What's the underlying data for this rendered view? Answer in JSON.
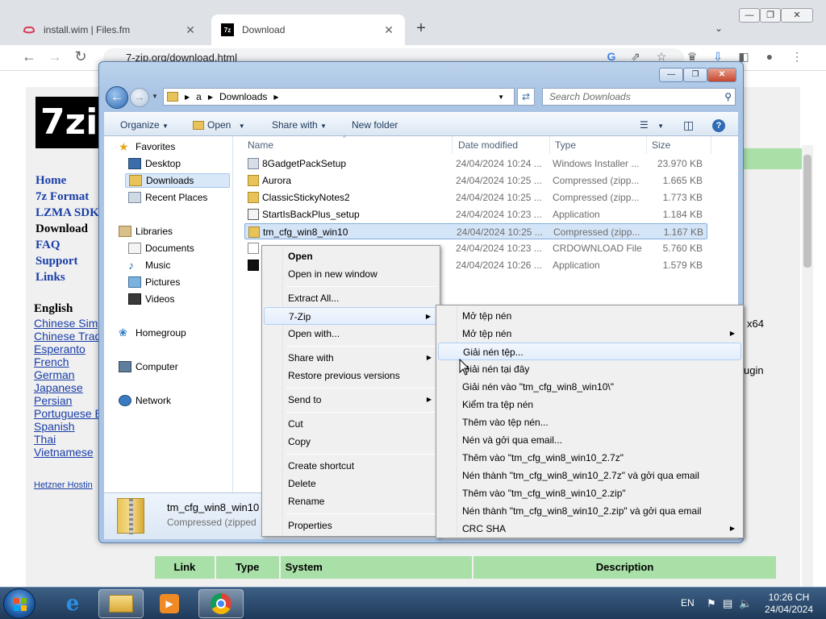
{
  "browser": {
    "tabs": [
      {
        "title": "install.wim | Files.fm",
        "close": "✕"
      },
      {
        "title": "Download",
        "close": "✕"
      }
    ],
    "new_tab": "+",
    "url": "7-zip.org/download.html",
    "window_buttons": {
      "minimize": "—",
      "restore": "❐",
      "close": "✕"
    }
  },
  "website": {
    "logo": "7zi",
    "nav": [
      "Home",
      "7z Format",
      "LZMA SDK",
      "Download",
      "FAQ",
      "Support",
      "Links"
    ],
    "languages_header": "English",
    "languages": [
      "Chinese Simp",
      "Chinese Trad",
      "Esperanto",
      "French",
      "German",
      "Japanese",
      "Persian",
      "Portuguese B",
      "Spanish",
      "Thai",
      "Vietnamese"
    ],
    "hosting": "Hetzner Hostin",
    "right_fragments": {
      "x64": "x64",
      "plugin": "ugin"
    },
    "table_headers": [
      "Link",
      "Type",
      "System",
      "Description"
    ]
  },
  "explorer": {
    "breadcrumb": [
      "a",
      "Downloads"
    ],
    "search_placeholder": "Search Downloads",
    "commands": [
      "Organize",
      "Open",
      "Share with",
      "New folder"
    ],
    "nav": {
      "favorites_header": "Favorites",
      "favorites": [
        "Desktop",
        "Downloads",
        "Recent Places"
      ],
      "libraries_header": "Libraries",
      "libraries": [
        "Documents",
        "Music",
        "Pictures",
        "Videos"
      ],
      "homegroup": "Homegroup",
      "computer": "Computer",
      "network": "Network"
    },
    "columns": [
      "Name",
      "Date modified",
      "Type",
      "Size"
    ],
    "files": [
      {
        "name": "8GadgetPackSetup",
        "date": "24/04/2024 10:24 ...",
        "type": "Windows Installer ...",
        "size": "23.970 KB"
      },
      {
        "name": "Aurora",
        "date": "24/04/2024 10:25 ...",
        "type": "Compressed (zipp...",
        "size": "1.665 KB"
      },
      {
        "name": "ClassicStickyNotes2",
        "date": "24/04/2024 10:25 ...",
        "type": "Compressed (zipp...",
        "size": "1.773 KB"
      },
      {
        "name": "StartIsBackPlus_setup",
        "date": "24/04/2024 10:23 ...",
        "type": "Application",
        "size": "1.184 KB"
      },
      {
        "name": "tm_cfg_win8_win10",
        "date": "24/04/2024 10:25 ...",
        "type": "Compressed (zipp...",
        "size": "1.167 KB"
      },
      {
        "name": "",
        "date": "24/04/2024 10:23 ...",
        "type": "CRDOWNLOAD File",
        "size": "5.760 KB"
      },
      {
        "name": "",
        "date": "24/04/2024 10:26 ...",
        "type": "Application",
        "size": "1.579 KB"
      }
    ],
    "details": {
      "name": "tm_cfg_win8_win10",
      "type": "Compressed (zipped"
    }
  },
  "context_menu": [
    {
      "label": "Open",
      "bold": true
    },
    {
      "label": "Open in new window"
    },
    {
      "sep": true
    },
    {
      "label": "Extract All..."
    },
    {
      "label": "7-Zip",
      "submenu": true,
      "highlight": true
    },
    {
      "label": "Open with..."
    },
    {
      "sep": true
    },
    {
      "label": "Share with",
      "submenu": true
    },
    {
      "label": "Restore previous versions"
    },
    {
      "sep": true
    },
    {
      "label": "Send to",
      "submenu": true
    },
    {
      "sep": true
    },
    {
      "label": "Cut"
    },
    {
      "label": "Copy"
    },
    {
      "sep": true
    },
    {
      "label": "Create shortcut"
    },
    {
      "label": "Delete"
    },
    {
      "label": "Rename"
    },
    {
      "sep": true
    },
    {
      "label": "Properties"
    }
  ],
  "zip_submenu": [
    {
      "label": "Mở tệp nén"
    },
    {
      "label": "Mở tệp nén",
      "submenu": true
    },
    {
      "label": "Giải nén tệp...",
      "highlight": true
    },
    {
      "label": "Giải nén tại đây"
    },
    {
      "label": "Giải nén vào \"tm_cfg_win8_win10\\\""
    },
    {
      "label": "Kiểm tra tệp nén"
    },
    {
      "label": "Thêm vào tệp nén..."
    },
    {
      "label": "Nén và gởi qua email..."
    },
    {
      "label": "Thêm vào \"tm_cfg_win8_win10_2.7z\""
    },
    {
      "label": "Nén thành \"tm_cfg_win8_win10_2.7z\" và gởi qua email"
    },
    {
      "label": "Thêm vào \"tm_cfg_win8_win10_2.zip\""
    },
    {
      "label": "Nén thành \"tm_cfg_win8_win10_2.zip\" và gởi qua email"
    },
    {
      "label": "CRC SHA",
      "submenu": true
    }
  ],
  "taskbar": {
    "language": "EN",
    "time": "10:26 CH",
    "date": "24/04/2024"
  },
  "colors": {
    "accent": "#1a73e8",
    "link": "#1a3ea8",
    "green_header": "#a8e0a8"
  }
}
